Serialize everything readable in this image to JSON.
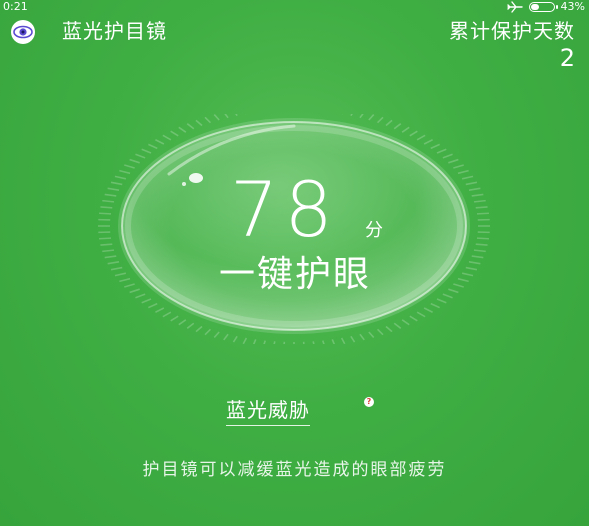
{
  "status_bar": {
    "time": "0:21",
    "battery_percent_label": "43%",
    "battery_level": 0.43
  },
  "header": {
    "title": "蓝光护目镜",
    "days_label": "累计保护天数",
    "days_value": "2"
  },
  "score": {
    "value": "78",
    "unit": "分"
  },
  "main_button": {
    "label": "一键护眼"
  },
  "threat": {
    "label": "蓝光威胁",
    "help_symbol": "?"
  },
  "description": "护目镜可以减缓蓝光造成的眼部疲劳",
  "colors": {
    "background": "#3fae43",
    "help_badge": "#e0413a",
    "logo_iris": "#5b4bd1"
  },
  "icons": {
    "status_airplane": "airplane-icon",
    "status_battery": "battery-icon",
    "app_logo": "eye-logo-icon",
    "help": "question-icon"
  }
}
